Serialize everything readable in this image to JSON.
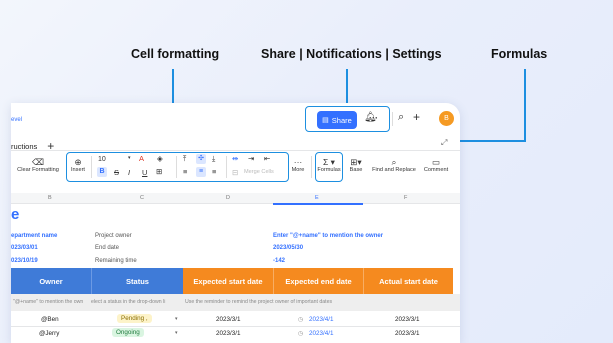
{
  "callouts": {
    "cell_formatting": "Cell formatting",
    "share_notifications_settings": "Share | Notifications | Settings",
    "formulas": "Formulas"
  },
  "breadcrumb": {
    "fragment": "evel"
  },
  "tabs": {
    "current": "ructions"
  },
  "topbar": {
    "share_label": "Share",
    "more_glyph": "···",
    "avatar_initial": "B"
  },
  "toolbar": {
    "clear_formatting": "Clear Formatting",
    "insert": "Insert",
    "font_size": "10",
    "merge_cells": "Merge Cells",
    "more": "More",
    "formulas": "Formulas",
    "base": "Base",
    "find_replace": "Find and Replace",
    "comment": "Comment"
  },
  "columns": [
    "B",
    "C",
    "D",
    "E",
    "F"
  ],
  "sheet": {
    "title_fragment": "e",
    "info": [
      {
        "left": "epartment name",
        "mid": "Project owner",
        "right": "Enter \"@+name\" to mention the owner"
      },
      {
        "left": "023/03/01",
        "mid": "End date",
        "right": "2023/05/30"
      },
      {
        "left": "023/10/19",
        "mid": "Remaining time",
        "right": "-142"
      }
    ],
    "headers": [
      "Owner",
      "Status",
      "Expected start date",
      "Expected end date",
      "Actual start date"
    ],
    "hints": [
      "\"@+name\" to mention the own",
      "elect a status in the drop-down li",
      "Use the reminder to remind the project owner of important dates"
    ],
    "rows": [
      {
        "owner": "@Ben",
        "status": "Pending ,",
        "start": "2023/3/1",
        "end": "2023/4/1",
        "actual": "2023/3/1"
      },
      {
        "owner": "@Jerry",
        "status": "Ongoing",
        "start": "2023/3/1",
        "end": "2023/4/1",
        "actual": "2023/3/1"
      }
    ]
  },
  "colors": {
    "accent": "#3370ff",
    "callout_line": "#1d8fe0",
    "header_blue": "#3f7bd8",
    "header_orange": "#f58a1f",
    "pending_bg": "#fdf3c9",
    "ongoing_bg": "#daf5e1"
  }
}
